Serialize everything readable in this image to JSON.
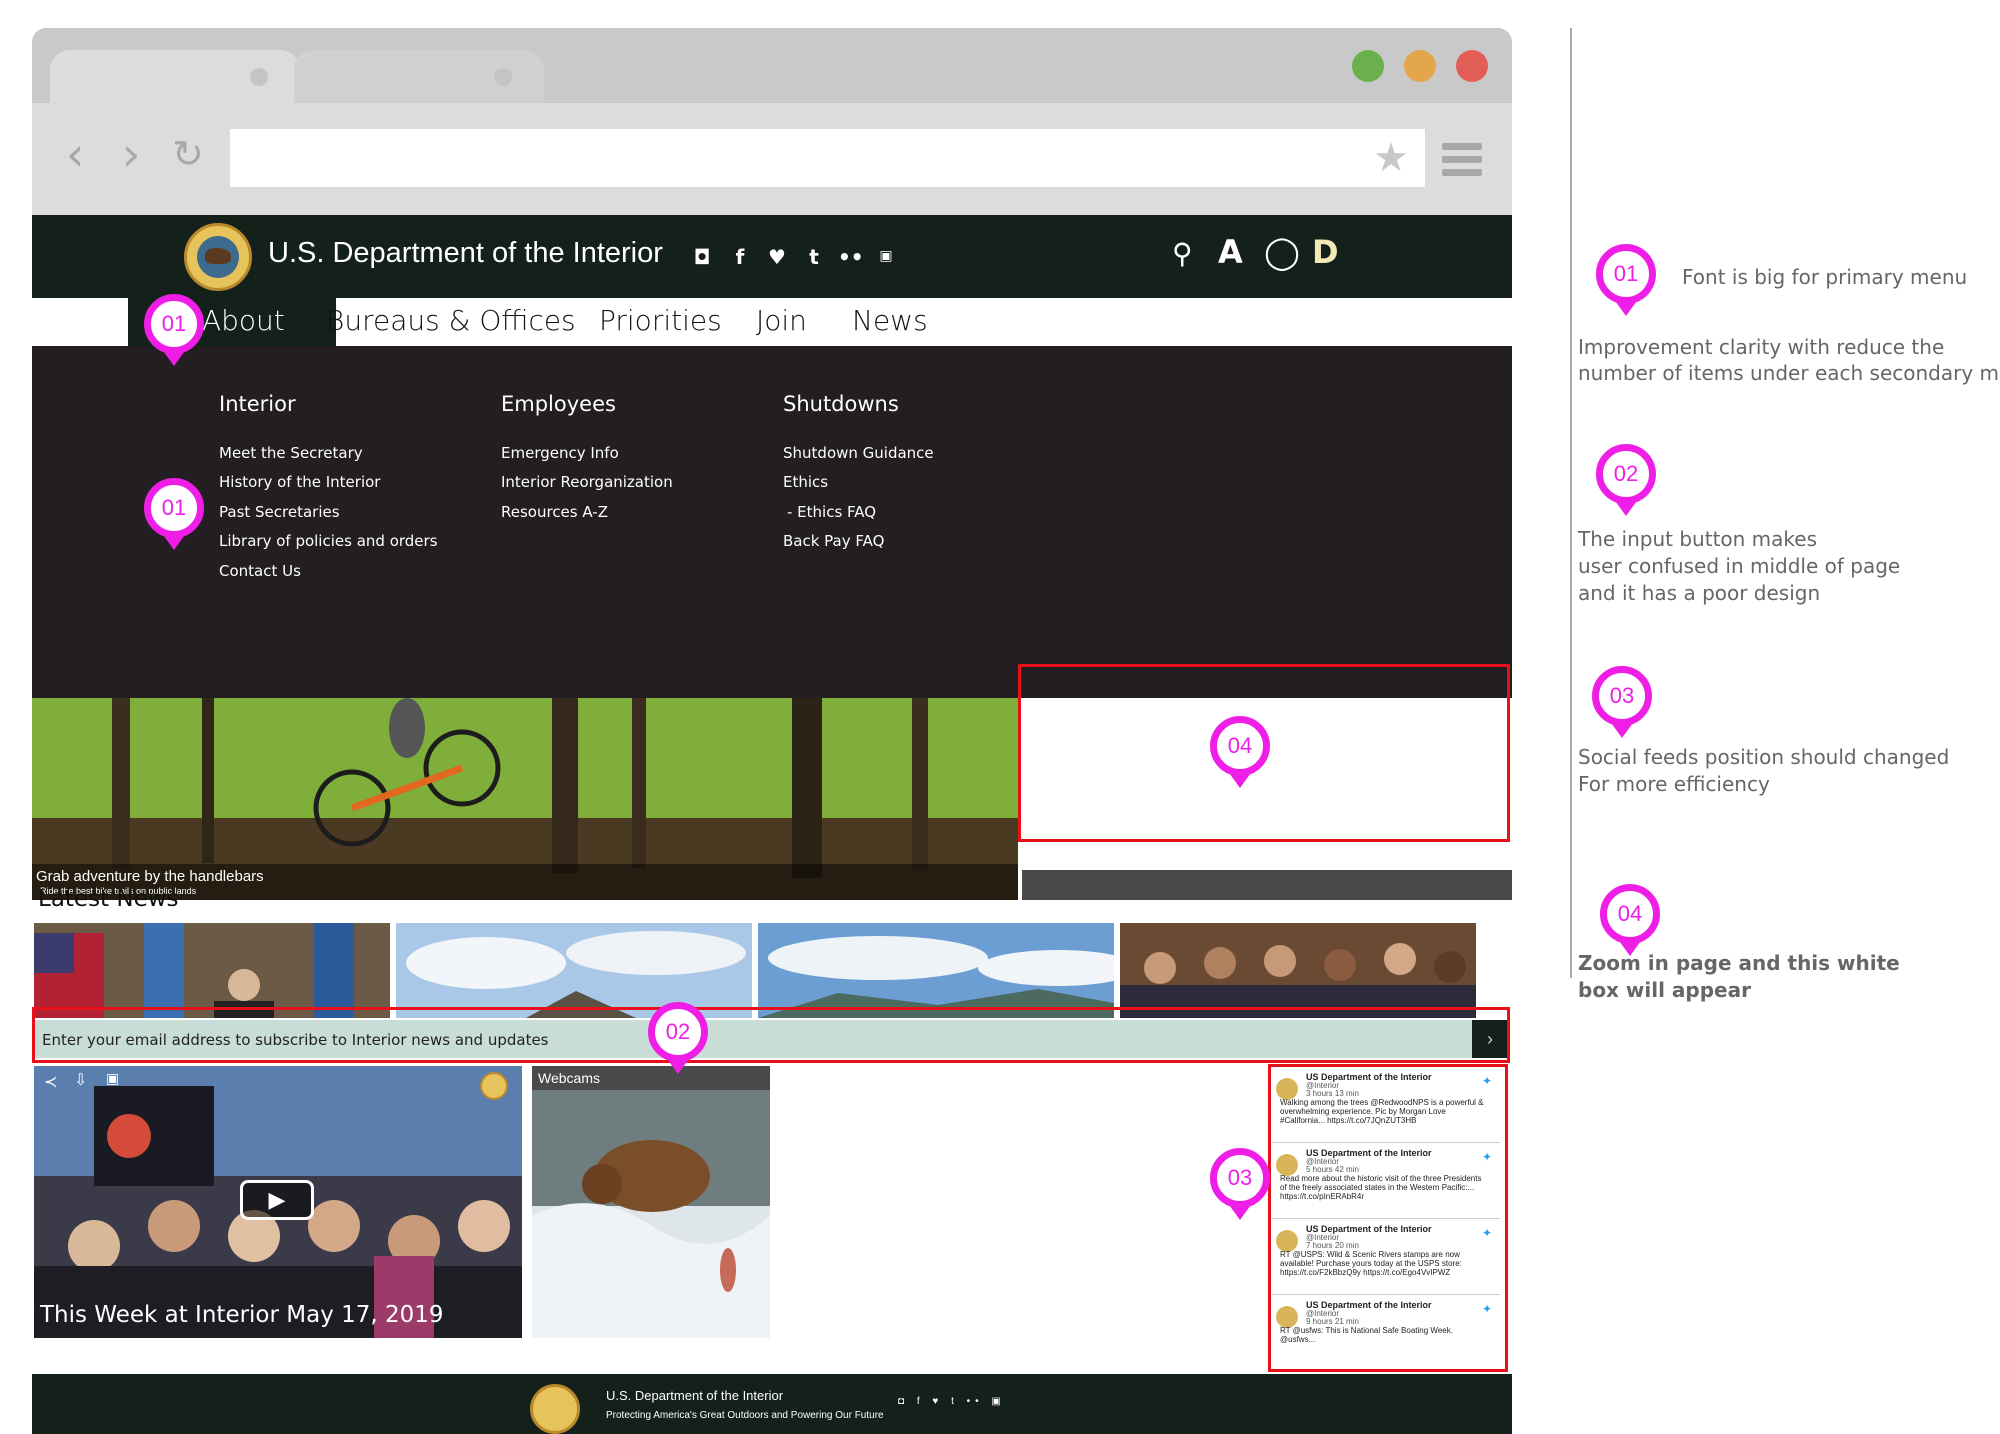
{
  "site": {
    "title": "U.S. Department of the Interior",
    "social_icons": [
      "instagram-icon",
      "facebook-icon",
      "twitter-icon",
      "tumblr-icon",
      "flickr-icon",
      "youtube-icon"
    ],
    "utility_icons": [
      "search-icon",
      "text-size-icon",
      "contrast-icon",
      "d-icon"
    ],
    "d_label": "D",
    "colors": {
      "header": "#14201a",
      "menu": "#221e21",
      "accent_pin": "#ee1ee6",
      "highlight": "#e8111a"
    }
  },
  "primary_nav": [
    "About",
    "Bureaus & Offices",
    "Priorities",
    "Join",
    "News"
  ],
  "mega_menu": [
    {
      "title": "Interior",
      "links": [
        "Meet the Secretary",
        "History of the Interior",
        "Past Secretaries",
        "Library of policies and orders",
        "Contact Us"
      ]
    },
    {
      "title": "Employees",
      "links": [
        "Emergency Info",
        "Interior Reorganization",
        "Resources A-Z"
      ]
    },
    {
      "title": "Shutdowns",
      "links": [
        "Shutdown Guidance",
        "Ethics",
        "- Ethics FAQ",
        "Back Pay FAQ"
      ]
    }
  ],
  "hero": {
    "caption": "Grab adventure by the handlebars",
    "sub": "Ride the best bike trails on public lands"
  },
  "latest_news": {
    "title": "Latest News"
  },
  "signup": {
    "text": "Enter your email address to subscribe to Interior news and updates",
    "button": "›"
  },
  "video": {
    "title": "This Week at Interior May 17, 2019"
  },
  "webcams": {
    "label": "Webcams"
  },
  "tweets": [
    {
      "name": "US Department of the Interior",
      "handle": "@Interior",
      "time": "3 hours 13 min",
      "text": "Walking among the trees @RedwoodNPS is a powerful & overwhelming experience. Pic by Morgan Love #California... https://t.co/7JQnZUT3HB"
    },
    {
      "name": "US Department of the Interior",
      "handle": "@Interior",
      "time": "5 hours 42 min",
      "text": "Read more about the historic visit of the three Presidents of the freely associated states in the Western Pacific:... https://t.co/pInERAbR4r"
    },
    {
      "name": "US Department of the Interior",
      "handle": "@Interior",
      "time": "7 hours 20 min",
      "text": "RT @USPS: Wild & Scenic Rivers stamps are now available! Purchase yours today at the USPS store: https://t.co/F2kBbzQ9y https://t.co/Ego4VvIPWZ"
    },
    {
      "name": "US Department of the Interior",
      "handle": "@Interior",
      "time": "9 hours 21 min",
      "text": "RT @usfws: This is National Safe Boating Week. @usfws..."
    }
  ],
  "footer": {
    "title": "U.S. Department of the Interior",
    "tagline": "Protecting America's Great Outdoors and Powering Our Future",
    "social": "◘ f ♥ t •• ▣"
  },
  "annotations": [
    {
      "num": "01",
      "lines": [
        "Font is big for primary menu",
        "Improvement clarity with reduce the",
        "number of items under each secondary menu"
      ]
    },
    {
      "num": "02",
      "lines": [
        "The input button makes",
        " user confused in middle of page",
        "and it has a poor design"
      ]
    },
    {
      "num": "03",
      "lines": [
        "Social feeds position should changed",
        "For more efficiency"
      ]
    },
    {
      "num": "04",
      "lines": [
        "Zoom in page and this white",
        "box will appear"
      ]
    }
  ]
}
